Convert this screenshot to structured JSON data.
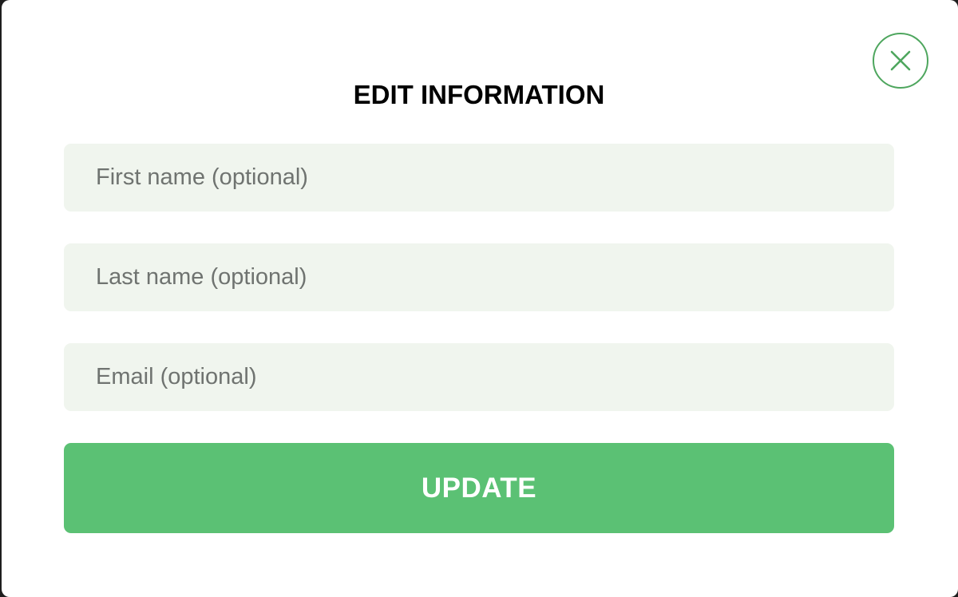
{
  "modal": {
    "title": "EDIT INFORMATION",
    "close_icon": "close-icon",
    "fields": [
      {
        "name": "first-name",
        "value": "",
        "placeholder": "First name (optional)"
      },
      {
        "name": "last-name",
        "value": "",
        "placeholder": "Last name (optional)"
      },
      {
        "name": "email",
        "value": "",
        "placeholder": "Email (optional)"
      }
    ],
    "submit_label": "UPDATE"
  },
  "colors": {
    "accent": "#5bc174",
    "close_border": "#4ea65e",
    "field_background": "#f0f5ee",
    "placeholder_text": "#6f7370",
    "title_text": "#000000"
  }
}
